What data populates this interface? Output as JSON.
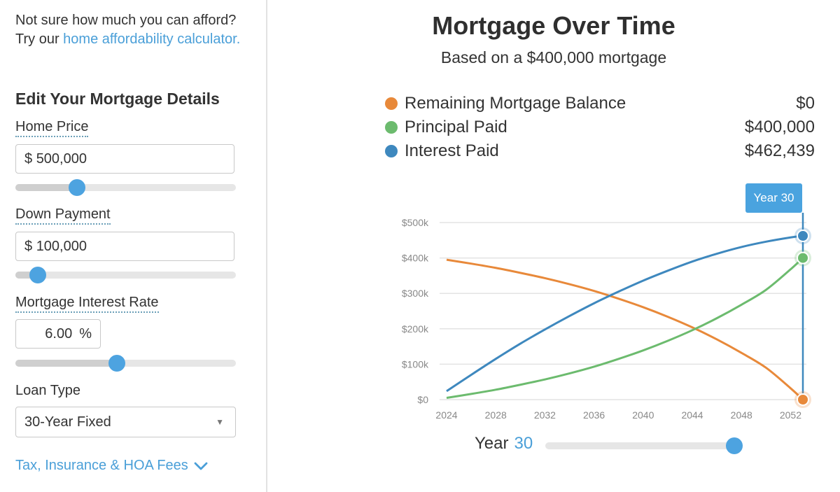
{
  "sidebar": {
    "intro_text": "Not sure how much you can afford? Try our ",
    "intro_link": "home affordability calculator.",
    "heading": "Edit Your Mortgage Details",
    "home_price": {
      "label": "Home Price",
      "currency": "$",
      "value": "500,000",
      "slider_fraction": 0.28
    },
    "down_payment": {
      "label": "Down Payment",
      "currency": "$",
      "value": "100,000",
      "slider_fraction": 0.1
    },
    "interest_rate": {
      "label": "Mortgage Interest Rate",
      "value": "6.00",
      "unit": "%",
      "slider_fraction": 0.46
    },
    "loan_type": {
      "label": "Loan Type",
      "selected": "30-Year Fixed"
    },
    "fees_link": "Tax, Insurance & HOA Fees"
  },
  "main": {
    "title": "Mortgage Over Time",
    "subtitle": "Based on a $400,000 mortgage",
    "legend": [
      {
        "name": "Remaining Mortgage Balance",
        "value": "$0",
        "color": "#e8893a"
      },
      {
        "name": "Principal Paid",
        "value": "$400,000",
        "color": "#6cbb6e"
      },
      {
        "name": "Interest Paid",
        "value": "$462,439",
        "color": "#3e88be"
      }
    ],
    "tooltip": "Year 30",
    "year_label": "Year",
    "year_value": "30",
    "year_slider_fraction": 1.0
  },
  "chart_data": {
    "type": "line",
    "title": "Mortgage Over Time",
    "xlabel": "",
    "ylabel": "",
    "x": [
      2024,
      2026,
      2028,
      2030,
      2032,
      2034,
      2036,
      2038,
      2040,
      2042,
      2044,
      2046,
      2048,
      2050,
      2052,
      2053
    ],
    "x_ticks": [
      "2024",
      "2028",
      "2032",
      "2036",
      "2040",
      "2044",
      "2048",
      "2052"
    ],
    "y_ticks": [
      "$0",
      "$100k",
      "$200k",
      "$300k",
      "$400k",
      "$500k"
    ],
    "ylim": [
      0,
      500000
    ],
    "xlim": [
      2024,
      2053
    ],
    "grid": true,
    "series": [
      {
        "name": "Remaining Mortgage Balance",
        "color": "#e8893a",
        "values": [
          395000,
          384000,
          372000,
          358000,
          343000,
          326000,
          307000,
          285000,
          261000,
          234000,
          204000,
          170000,
          132000,
          90000,
          32000,
          0
        ]
      },
      {
        "name": "Principal Paid",
        "color": "#6cbb6e",
        "values": [
          5000,
          16000,
          28000,
          42000,
          57000,
          74000,
          93000,
          115000,
          139000,
          166000,
          196000,
          230000,
          268000,
          310000,
          368000,
          400000
        ]
      },
      {
        "name": "Interest Paid",
        "color": "#3e88be",
        "values": [
          24000,
          70000,
          115000,
          158000,
          198000,
          236000,
          272000,
          305000,
          336000,
          364000,
          390000,
          412000,
          431000,
          446000,
          458000,
          462439
        ]
      }
    ],
    "highlight": {
      "x": 2053,
      "label": "Year 30"
    }
  }
}
